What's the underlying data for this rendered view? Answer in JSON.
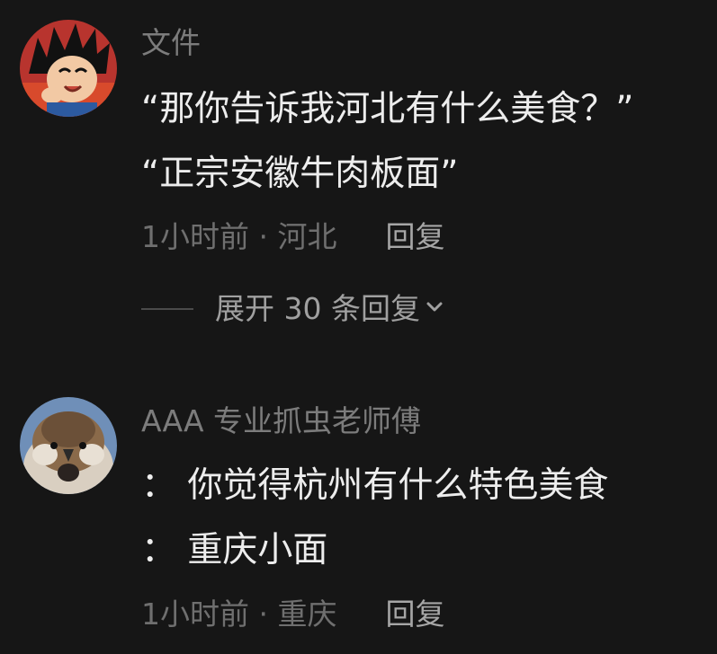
{
  "comments": [
    {
      "username": "文件",
      "lines": [
        "“那你告诉我河北有什么美食？”",
        "“正宗安徽牛肉板面”"
      ],
      "time": "1小时前 · 河北",
      "reply_label": "回复",
      "expand_label": "展开 30 条回复"
    },
    {
      "username": "AAA 专业抓虫老师傅",
      "lines": [
        "： 你觉得杭州有什么特色美食",
        "： 重庆小面"
      ],
      "time": "1小时前 · 重庆",
      "reply_label": "回复"
    }
  ],
  "icons": {
    "expand_chevron": "chevron-down-icon",
    "avatar_1": "cartoon-boy-avatar",
    "avatar_2": "sparrow-avatar"
  },
  "colors": {
    "background": "#161616",
    "primary_text": "#ededed",
    "secondary_text": "#7c7c7c",
    "reply_text": "#a6a6a6"
  }
}
